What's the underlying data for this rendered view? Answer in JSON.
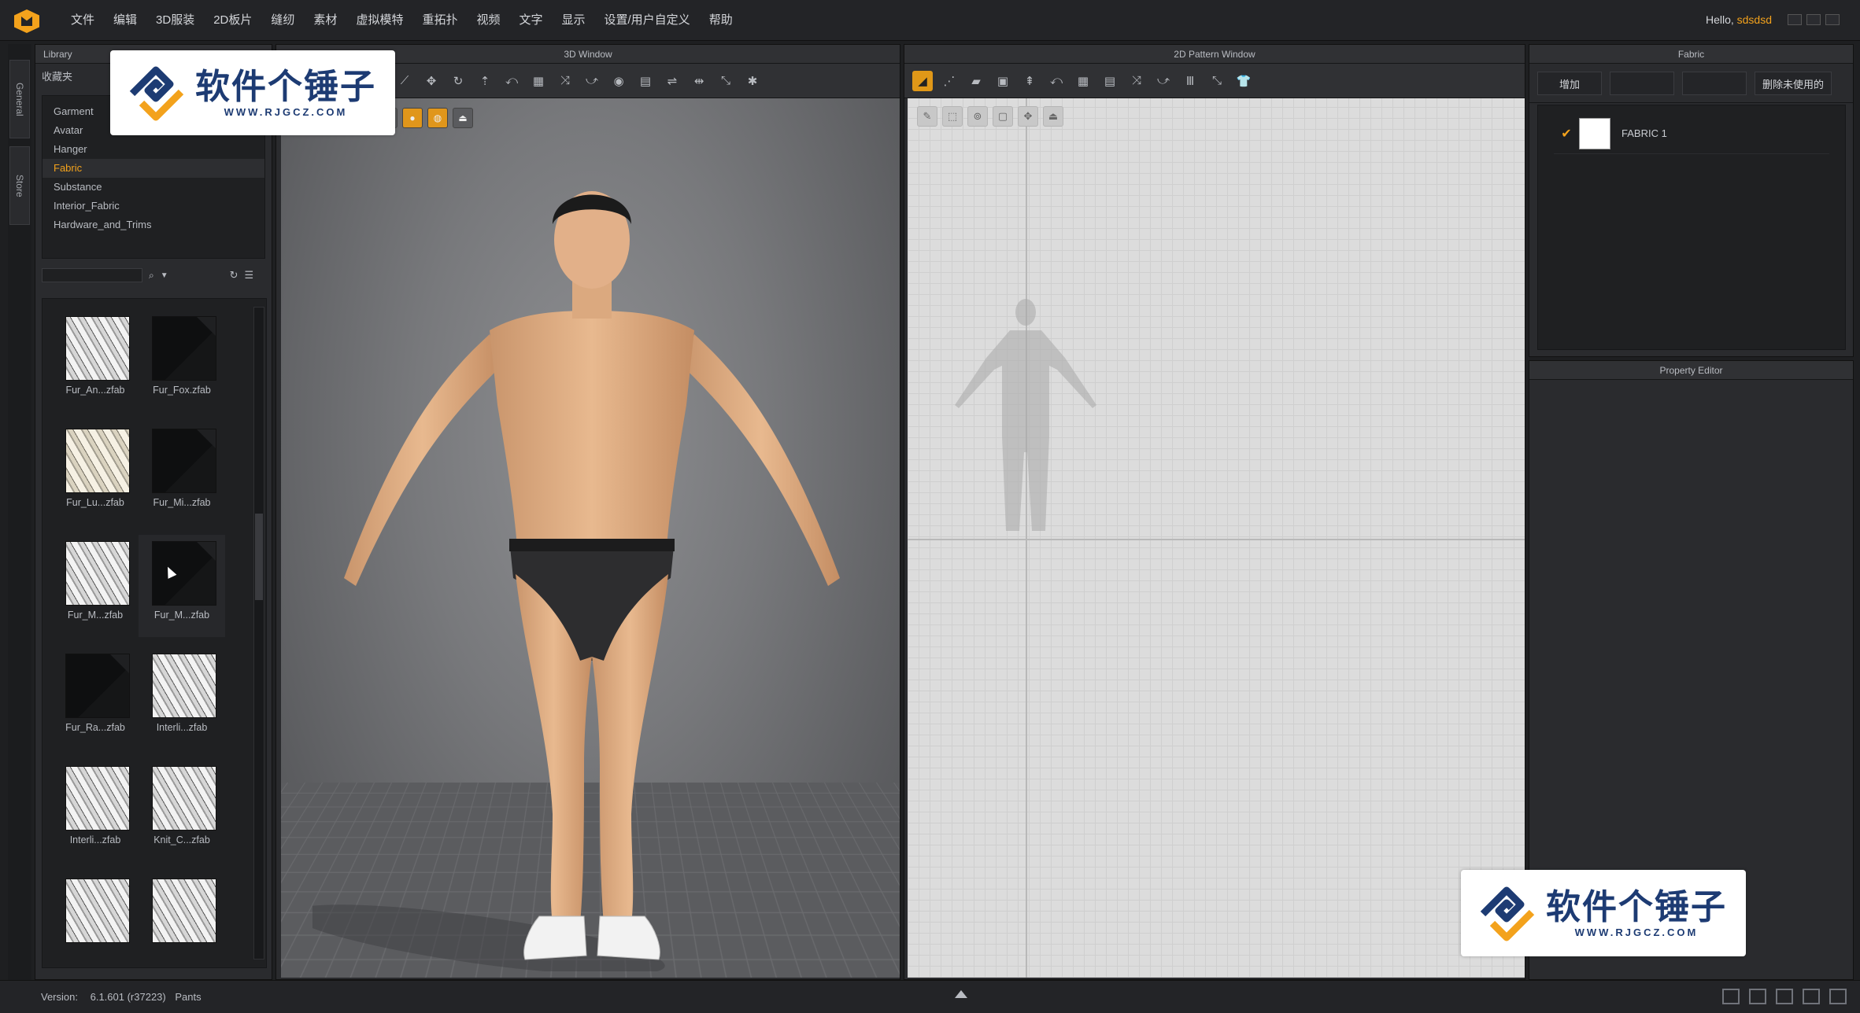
{
  "menubar": {
    "items": [
      "文件",
      "编辑",
      "3D服装",
      "2D板片",
      "缝纫",
      "素材",
      "虚拟模特",
      "重拓扑",
      "视频",
      "文字",
      "显示",
      "设置/用户自定义",
      "帮助"
    ],
    "hello_prefix": "Hello, ",
    "user": "sdsdsd"
  },
  "side_tabs": [
    "General",
    "Store"
  ],
  "library": {
    "header": "Library",
    "favorites_label": "收藏夹",
    "tree": [
      "Garment",
      "Avatar",
      "Hanger",
      "Fabric",
      "Substance",
      "Interior_Fabric",
      "Hardware_and_Trims"
    ],
    "selected_tree_index": 3,
    "search_placeholder": "",
    "thumbnails": [
      {
        "label": "Fur_An...zfab",
        "style": "light"
      },
      {
        "label": "Fur_Fox.zfab",
        "style": "dark"
      },
      {
        "label": "Fur_Lu...zfab",
        "style": "cream"
      },
      {
        "label": "Fur_Mi...zfab",
        "style": "dark"
      },
      {
        "label": "Fur_M...zfab",
        "style": "light"
      },
      {
        "label": "Fur_M...zfab",
        "style": "dark"
      },
      {
        "label": "Fur_Ra...zfab",
        "style": "dark"
      },
      {
        "label": "Interli...zfab",
        "style": "light"
      },
      {
        "label": "Interli...zfab",
        "style": "light"
      },
      {
        "label": "Knit_C...zfab",
        "style": "light"
      },
      {
        "label": "",
        "style": "light"
      },
      {
        "label": "",
        "style": "light"
      }
    ]
  },
  "window3d": {
    "title": "3D Window"
  },
  "window2d": {
    "title": "2D Pattern Window"
  },
  "fabric_panel": {
    "title": "Fabric",
    "buttons": [
      "增加",
      "",
      "",
      "删除未使用的"
    ],
    "fabric_name": "FABRIC 1"
  },
  "property_editor": {
    "title": "Property Editor"
  },
  "status": {
    "version_label": "Version:",
    "version": "6.1.601 (r37223)",
    "mode": "Pants"
  },
  "watermark": {
    "cn": "软件个锤子",
    "en": "WWW.RJGCZ.COM"
  },
  "colors": {
    "accent": "#f3a21c",
    "panel": "#2a2b2e",
    "bg": "#1e1f21"
  }
}
